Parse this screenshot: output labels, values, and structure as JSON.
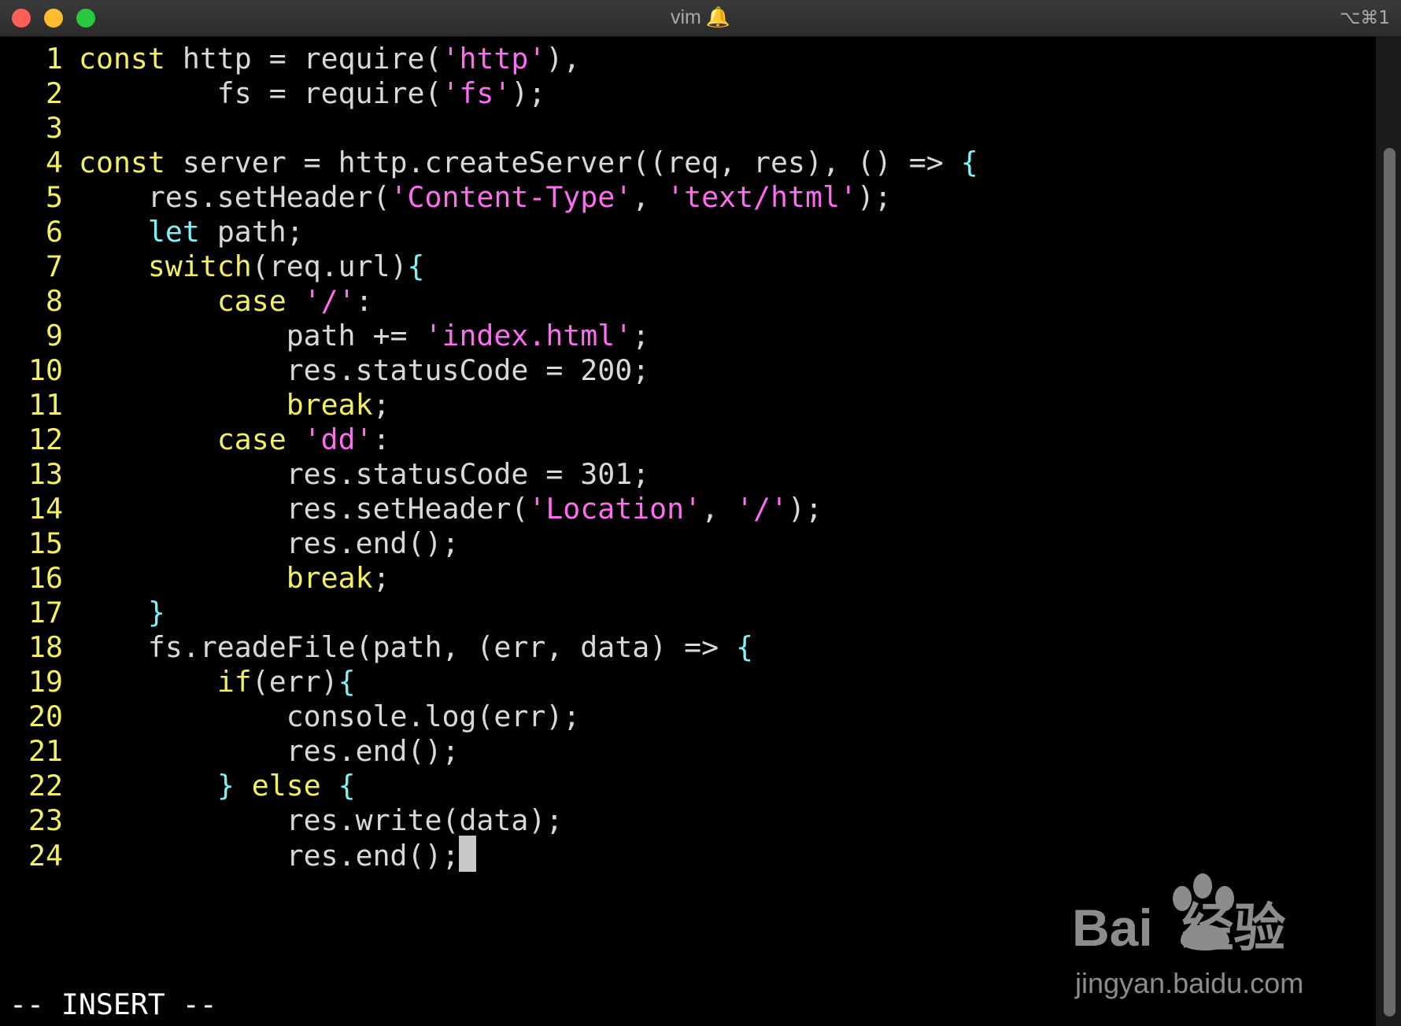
{
  "window": {
    "title": "vim",
    "title_icon": "bell-icon",
    "shortcut": "⌥⌘1"
  },
  "editor": {
    "mode_indicator": "-- INSERT --",
    "lines": [
      {
        "number": "1",
        "tokens": [
          {
            "t": "kw",
            "v": "const"
          },
          {
            "t": "plain",
            "v": " http = require("
          },
          {
            "t": "str",
            "v": "'http'"
          },
          {
            "t": "plain",
            "v": "),"
          }
        ]
      },
      {
        "number": "2",
        "tokens": [
          {
            "t": "plain",
            "v": "        fs = require("
          },
          {
            "t": "str",
            "v": "'fs'"
          },
          {
            "t": "plain",
            "v": ");"
          }
        ]
      },
      {
        "number": "3",
        "tokens": []
      },
      {
        "number": "4",
        "tokens": [
          {
            "t": "kw",
            "v": "const"
          },
          {
            "t": "plain",
            "v": " server = http.createServer((req, res), () => "
          },
          {
            "t": "brace",
            "v": "{"
          }
        ]
      },
      {
        "number": "5",
        "tokens": [
          {
            "t": "plain",
            "v": "    res.setHeader("
          },
          {
            "t": "str",
            "v": "'Content-Type'"
          },
          {
            "t": "plain",
            "v": ", "
          },
          {
            "t": "str",
            "v": "'text/html'"
          },
          {
            "t": "plain",
            "v": ");"
          }
        ]
      },
      {
        "number": "6",
        "tokens": [
          {
            "t": "plain",
            "v": "    "
          },
          {
            "t": "brace",
            "v": "let"
          },
          {
            "t": "plain",
            "v": " path;"
          }
        ]
      },
      {
        "number": "7",
        "tokens": [
          {
            "t": "plain",
            "v": "    "
          },
          {
            "t": "kw",
            "v": "switch"
          },
          {
            "t": "plain",
            "v": "(req.url)"
          },
          {
            "t": "brace",
            "v": "{"
          }
        ]
      },
      {
        "number": "8",
        "tokens": [
          {
            "t": "plain",
            "v": "        "
          },
          {
            "t": "kw",
            "v": "case"
          },
          {
            "t": "plain",
            "v": " "
          },
          {
            "t": "str",
            "v": "'/'"
          },
          {
            "t": "plain",
            "v": ":"
          }
        ]
      },
      {
        "number": "9",
        "tokens": [
          {
            "t": "plain",
            "v": "            path += "
          },
          {
            "t": "str",
            "v": "'index.html'"
          },
          {
            "t": "plain",
            "v": ";"
          }
        ]
      },
      {
        "number": "10",
        "tokens": [
          {
            "t": "plain",
            "v": "            res.statusCode = 200;"
          }
        ]
      },
      {
        "number": "11",
        "tokens": [
          {
            "t": "plain",
            "v": "            "
          },
          {
            "t": "kw",
            "v": "break"
          },
          {
            "t": "plain",
            "v": ";"
          }
        ]
      },
      {
        "number": "12",
        "tokens": [
          {
            "t": "plain",
            "v": "        "
          },
          {
            "t": "kw",
            "v": "case"
          },
          {
            "t": "plain",
            "v": " "
          },
          {
            "t": "str",
            "v": "'dd'"
          },
          {
            "t": "plain",
            "v": ":"
          }
        ]
      },
      {
        "number": "13",
        "tokens": [
          {
            "t": "plain",
            "v": "            res.statusCode = 301;"
          }
        ]
      },
      {
        "number": "14",
        "tokens": [
          {
            "t": "plain",
            "v": "            res.setHeader("
          },
          {
            "t": "str",
            "v": "'Location'"
          },
          {
            "t": "plain",
            "v": ", "
          },
          {
            "t": "str",
            "v": "'/'"
          },
          {
            "t": "plain",
            "v": ");"
          }
        ]
      },
      {
        "number": "15",
        "tokens": [
          {
            "t": "plain",
            "v": "            res.end();"
          }
        ]
      },
      {
        "number": "16",
        "tokens": [
          {
            "t": "plain",
            "v": "            "
          },
          {
            "t": "kw",
            "v": "break"
          },
          {
            "t": "plain",
            "v": ";"
          }
        ]
      },
      {
        "number": "17",
        "tokens": [
          {
            "t": "plain",
            "v": "    "
          },
          {
            "t": "brace",
            "v": "}"
          }
        ]
      },
      {
        "number": "18",
        "tokens": [
          {
            "t": "plain",
            "v": "    fs.readeFile(path, (err, data) => "
          },
          {
            "t": "brace",
            "v": "{"
          }
        ]
      },
      {
        "number": "19",
        "tokens": [
          {
            "t": "plain",
            "v": "        "
          },
          {
            "t": "kw",
            "v": "if"
          },
          {
            "t": "plain",
            "v": "(err)"
          },
          {
            "t": "brace",
            "v": "{"
          }
        ]
      },
      {
        "number": "20",
        "tokens": [
          {
            "t": "plain",
            "v": "            console.log(err);"
          }
        ]
      },
      {
        "number": "21",
        "tokens": [
          {
            "t": "plain",
            "v": "            res.end();"
          }
        ]
      },
      {
        "number": "22",
        "tokens": [
          {
            "t": "plain",
            "v": "        "
          },
          {
            "t": "brace",
            "v": "}"
          },
          {
            "t": "plain",
            "v": " "
          },
          {
            "t": "kw",
            "v": "else"
          },
          {
            "t": "plain",
            "v": " "
          },
          {
            "t": "brace",
            "v": "{"
          }
        ]
      },
      {
        "number": "23",
        "tokens": [
          {
            "t": "plain",
            "v": "            res.write(data);"
          }
        ]
      },
      {
        "number": "24",
        "tokens": [
          {
            "t": "plain",
            "v": "            res.end();"
          }
        ],
        "cursor": true
      }
    ]
  },
  "watermark": {
    "logo_text": "Bai  经验",
    "logo_sub": "du",
    "url": "jingyan.baidu.com"
  },
  "colors": {
    "background": "#000000",
    "line_number": "#f4ef61",
    "keyword": "#f4ef61",
    "string": "#ff6bf1",
    "brace": "#7ff0f4",
    "plain": "#d8d8d8"
  }
}
